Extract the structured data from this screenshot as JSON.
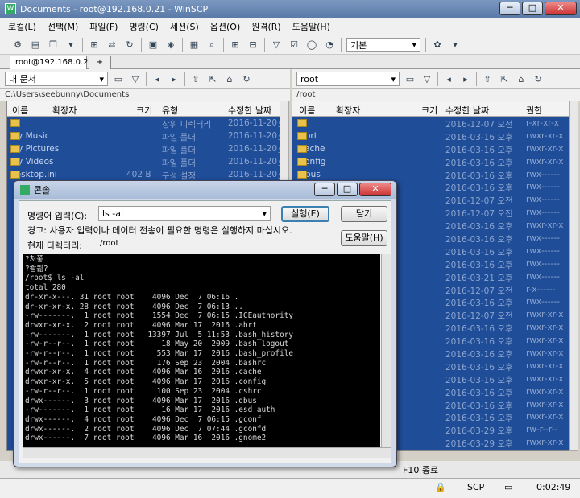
{
  "window": {
    "title": "Documents - root@192.168.0.21 - WinSCP",
    "min": "─",
    "max": "□",
    "close": "✕"
  },
  "menu": [
    "로컬(L)",
    "선택(M)",
    "파일(F)",
    "명령(C)",
    "세션(S)",
    "옵션(O)",
    "원격(R)",
    "도움말(H)"
  ],
  "toolbar": {
    "transfer_profile": "기본"
  },
  "tabs": {
    "session": "root@192.168.0.21",
    "new": "+"
  },
  "left": {
    "location": "내 문서",
    "path": "C:\\Users\\seebunny\\Documents",
    "columns": [
      "이름",
      "확장자",
      "크기",
      "유형",
      "수정한 날짜"
    ],
    "rows": [
      {
        "name": "..",
        "size": "",
        "type": "상위 디렉터리",
        "date": "2016-11-20",
        "time": "오"
      },
      {
        "name": "My Music",
        "size": "",
        "type": "파일 폴더",
        "date": "2016-11-20",
        "time": "오"
      },
      {
        "name": "My Pictures",
        "size": "",
        "type": "파일 폴더",
        "date": "2016-11-20",
        "time": "오"
      },
      {
        "name": "My Videos",
        "size": "",
        "type": "파일 폴더",
        "date": "2016-11-20",
        "time": "오"
      },
      {
        "name": "desktop.ini",
        "size": "402 B",
        "type": "구성 설정",
        "date": "2016-11-20",
        "time": "오"
      }
    ]
  },
  "right": {
    "location": "root",
    "path": "/root",
    "columns": [
      "이름",
      "확장자",
      "크기",
      "수정한 날짜",
      "권한"
    ],
    "rows": [
      {
        "name": "..",
        "date": "2016-12-07 오전",
        "perm": "r-xr-xr-x"
      },
      {
        "name": ".abrt",
        "date": "2016-03-16 오후",
        "perm": "rwxr-xr-x"
      },
      {
        "name": ".cache",
        "date": "2016-03-16 오후",
        "perm": "rwxr-xr-x"
      },
      {
        "name": ".config",
        "date": "2016-03-16 오후",
        "perm": "rwxr-xr-x"
      },
      {
        "name": ".dbus",
        "date": "2016-03-16 오후",
        "perm": "rwx------"
      },
      {
        "name": "",
        "date": "2016-03-16 오후",
        "perm": "rwx------"
      },
      {
        "name": "",
        "date": "2016-12-07 오전",
        "perm": "rwx------"
      },
      {
        "name": "",
        "date": "2016-12-07 오전",
        "perm": "rwx------"
      },
      {
        "name": "",
        "date": "2016-03-16 오후",
        "perm": "rwxr-xr-x"
      },
      {
        "name": "",
        "date": "2016-03-16 오후",
        "perm": "rwx------"
      },
      {
        "name": "",
        "date": "2016-03-16 오후",
        "perm": "rwx------"
      },
      {
        "name": "",
        "date": "2016-03-16 오후",
        "perm": "rwx------"
      },
      {
        "name": "",
        "date": "2016-03-21 오후",
        "perm": "rwx------"
      },
      {
        "name": "",
        "date": "2016-12-07 오전",
        "perm": "r-x------"
      },
      {
        "name": "",
        "date": "2016-03-16 오후",
        "perm": "rwx------"
      },
      {
        "name": "",
        "date": "2016-12-07 오전",
        "perm": "rwxr-xr-x"
      },
      {
        "name": "",
        "date": "2016-03-16 오후",
        "perm": "rwxr-xr-x"
      },
      {
        "name": "",
        "date": "2016-03-16 오후",
        "perm": "rwxr-xr-x"
      },
      {
        "name": "",
        "date": "2016-03-16 오후",
        "perm": "rwxr-xr-x"
      },
      {
        "name": "",
        "date": "2016-03-16 오후",
        "perm": "rwxr-xr-x"
      },
      {
        "name": "",
        "date": "2016-03-16 오후",
        "perm": "rwxr-xr-x"
      },
      {
        "name": "",
        "date": "2016-03-16 오후",
        "perm": "rwxr-xr-x"
      },
      {
        "name": "",
        "date": "2016-03-16 오후",
        "perm": "rwxr-xr-x"
      },
      {
        "name": "",
        "date": "2016-03-16 오후",
        "perm": "rwxr-xr-x"
      },
      {
        "name": "",
        "date": "2016-03-29 오후",
        "perm": "rw-r--r--"
      },
      {
        "name": "",
        "date": "2016-03-29 오후",
        "perm": "rwxr-xr-x"
      },
      {
        "name": "",
        "date": "2016-03-29 오전",
        "perm": "rwxr-xr-x"
      }
    ]
  },
  "console": {
    "title": "콘솔",
    "cmd_label": "명령어 입력(C):",
    "cmd_value": "ls -al",
    "warning": "경고: 사용자 입력이나 데이터 전송이 필요한 명령은 실행하지 마십시오.",
    "cwd_label": "현재 디렉터리:",
    "cwd_value": "/root",
    "execute": "실행(E)",
    "close": "닫기",
    "help": "도움말(H)",
    "output": "?쳐쫗\n?쐍뵒?\n/root$ ls -al\ntotal 280\ndr-xr-x---. 31 root root    4096 Dec  7 06:16 .\ndr-xr-xr-x. 28 root root    4096 Dec  7 06:13 ..\n-rw-------.  1 root root    1554 Dec  7 06:15 .ICEauthority\ndrwxr-xr-x.  2 root root    4096 Mar 17  2016 .abrt\n-rw-------.  1 root root   13397 Jul  5 11:53 .bash_history\n-rw-r--r--.  1 root root      18 May 20  2009 .bash_logout\n-rw-r--r--.  1 root root     553 Mar 17  2016 .bash_profile\n-rw-r--r--.  1 root root     176 Sep 23  2004 .bashrc\ndrwxr-xr-x.  4 root root    4096 Mar 16  2016 .cache\ndrwxr-xr-x.  5 root root    4096 Mar 17  2016 .config\n-rw-r--r--.  1 root root     100 Sep 23  2004 .cshrc\ndrwx------.  3 root root    4096 Mar 17  2016 .dbus\n-rw-------.  1 root root      16 Mar 17  2016 .esd_auth\ndrwx------.  4 root root    4096 Dec  7 06:15 .gconf\ndrwx------.  2 root root    4096 Dec  7 07:44 .gconfd\ndrwx------.  7 root root    4096 Mar 16  2016 .gnome2"
  },
  "fkeys": {
    "f10": "F10 종료"
  },
  "status": {
    "protocol": "SCP",
    "elapsed": "0:02:49"
  }
}
